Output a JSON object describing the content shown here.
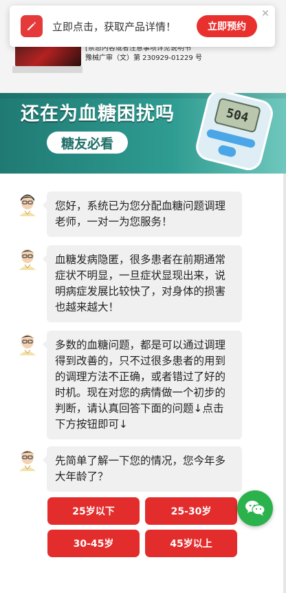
{
  "product": {
    "reg_line1": "[禁忌内容或者注意事项详见说明书",
    "reg_line2": "豫械广审（文）第 230929-01229 号"
  },
  "popup": {
    "message": "立即点击，获取产品详情！",
    "cta_label": "立即预约",
    "close_glyph": "✕"
  },
  "banner": {
    "title": "还在为血糖困扰吗",
    "pill": "糖友必看",
    "meter_reading": "504"
  },
  "chat": {
    "messages": [
      {
        "text": "您好，系统已为您分配血糖问题调理老师，一对一为您服务！"
      },
      {
        "text": "血糖发病隐匿，很多患者在前期通常症状不明显，一旦症状显现出来，说明病症发展比较快了，对身体的损害也越来越大！"
      },
      {
        "text": "多数的血糖问题，都是可以通过调理得到改善的，只不过很多患者的用到的调理方法不正确，或者错过了好的时机。现在对您的病情做一个初步的判断，请认真回答下面的问题↓点击下方按钮即可↓"
      },
      {
        "text": "先简单了解一下您的情况，您今年多大年龄了？"
      }
    ],
    "options": [
      "25岁以下",
      "25-30岁",
      "30-45岁",
      "45岁以上"
    ]
  },
  "icons": {
    "popup": "pencil-icon",
    "float": "wechat-icon",
    "avatar": "doctor-avatar"
  },
  "colors": {
    "accent_red": "#e32d2d",
    "banner_teal": "#2f9c91",
    "wechat_green": "#2bb24c"
  }
}
